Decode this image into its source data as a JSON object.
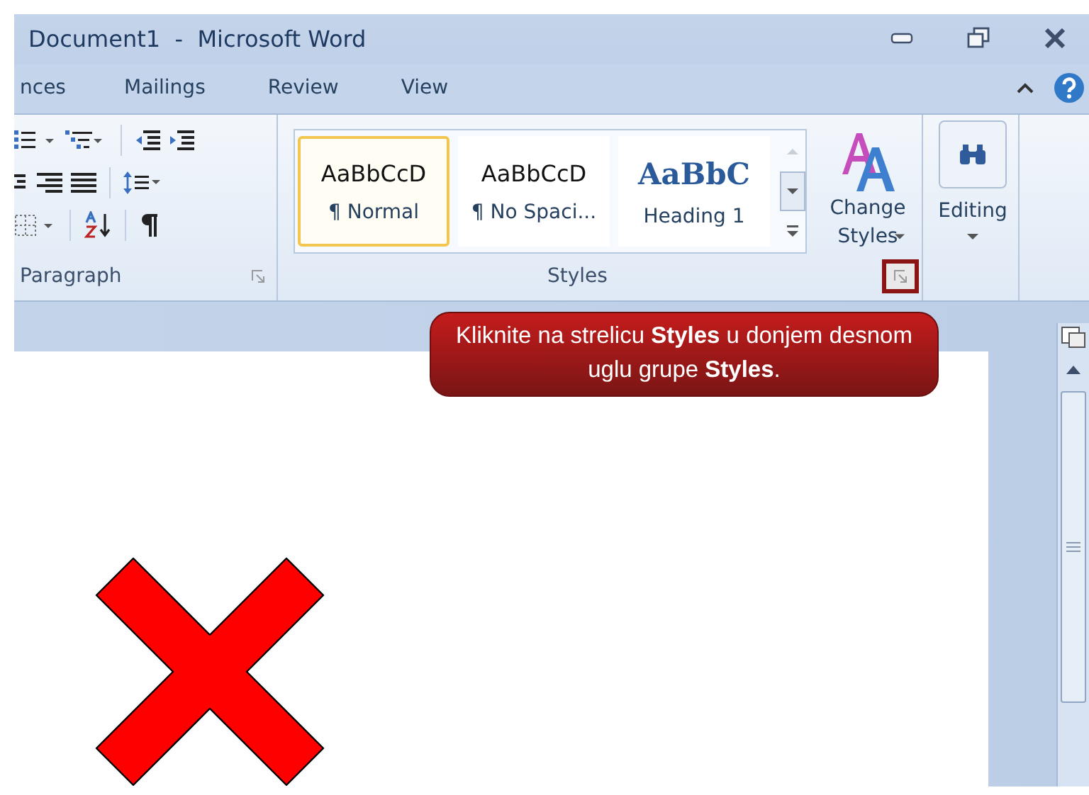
{
  "window": {
    "title": "Document1  -  Microsoft Word"
  },
  "tabs": [
    {
      "label": "nces",
      "selected": false
    },
    {
      "label": "Mailings",
      "selected": false
    },
    {
      "label": "Review",
      "selected": false
    },
    {
      "label": "View",
      "selected": false
    }
  ],
  "ribbon": {
    "paragraph": {
      "label": "Paragraph"
    },
    "styles": {
      "label": "Styles",
      "launcher": {
        "highlighted": true
      },
      "gallery": [
        {
          "sample": "AaBbCcD",
          "name": "¶ Normal",
          "kind": "body",
          "selected": true
        },
        {
          "sample": "AaBbCcD",
          "name": "¶ No Spaci...",
          "kind": "body",
          "selected": false
        },
        {
          "sample": "AaBbC",
          "name": "Heading 1",
          "kind": "heading",
          "selected": false
        }
      ],
      "change_styles": "Change Styles"
    },
    "editing": {
      "label": "Editing"
    }
  },
  "callout": {
    "text": "Kliknite na strelicu **Styles** u donjem desnom uglu grupe **Styles**."
  }
}
